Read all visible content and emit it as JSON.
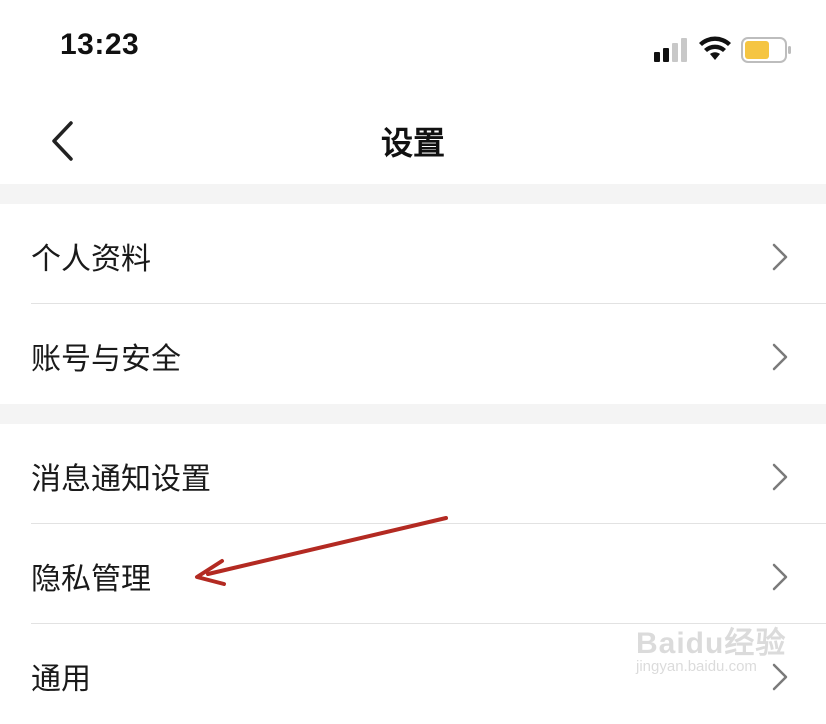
{
  "status_bar": {
    "time": "13:23",
    "icons": [
      "signal-icon",
      "wifi-icon",
      "battery-icon"
    ],
    "battery_color": "#f5c542"
  },
  "nav": {
    "title": "设置",
    "back_icon": "chevron-left-icon"
  },
  "menu": {
    "items": [
      {
        "label": "个人资料",
        "icon": "chevron-right-icon"
      },
      {
        "label": "账号与安全",
        "icon": "chevron-right-icon"
      },
      {
        "label": "消息通知设置",
        "icon": "chevron-right-icon"
      },
      {
        "label": "隐私管理",
        "icon": "chevron-right-icon"
      },
      {
        "label": "通用",
        "icon": "chevron-right-icon"
      }
    ]
  },
  "annotation": {
    "arrow_color": "#b32a22",
    "target": "隐私管理"
  },
  "watermark": {
    "brand": "Baidu经验",
    "url": "jingyan.baidu.com"
  }
}
